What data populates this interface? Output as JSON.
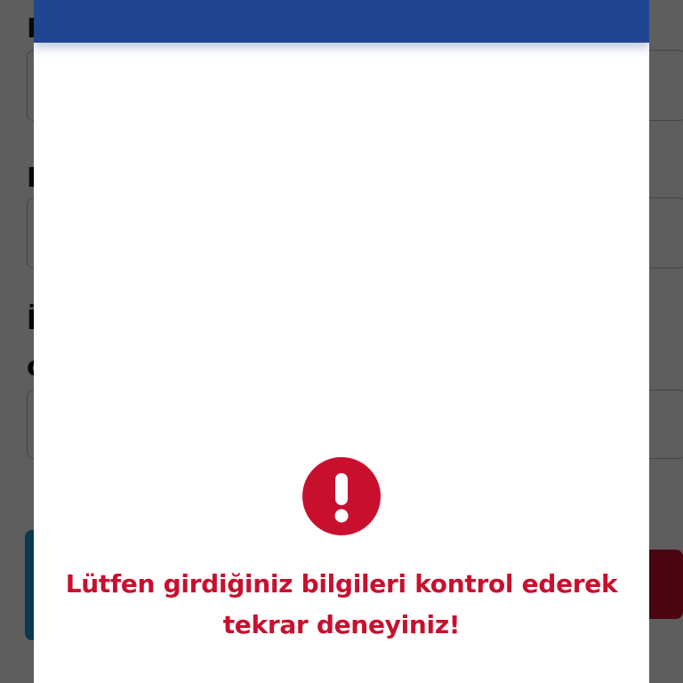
{
  "background_page": {
    "label_1": "E",
    "label_2": "M",
    "label_3_line_1": "İ",
    "label_3_line_2": "c"
  },
  "modal": {
    "header_color": "#214591",
    "icon": "exclamation-circle-icon",
    "icon_color": "#c8102e",
    "message_line_1": "Lütfen girdiğiniz bilgileri kontrol ederek",
    "message_line_2": "tekrar deneyiniz!",
    "message_color": "#c8102e"
  }
}
